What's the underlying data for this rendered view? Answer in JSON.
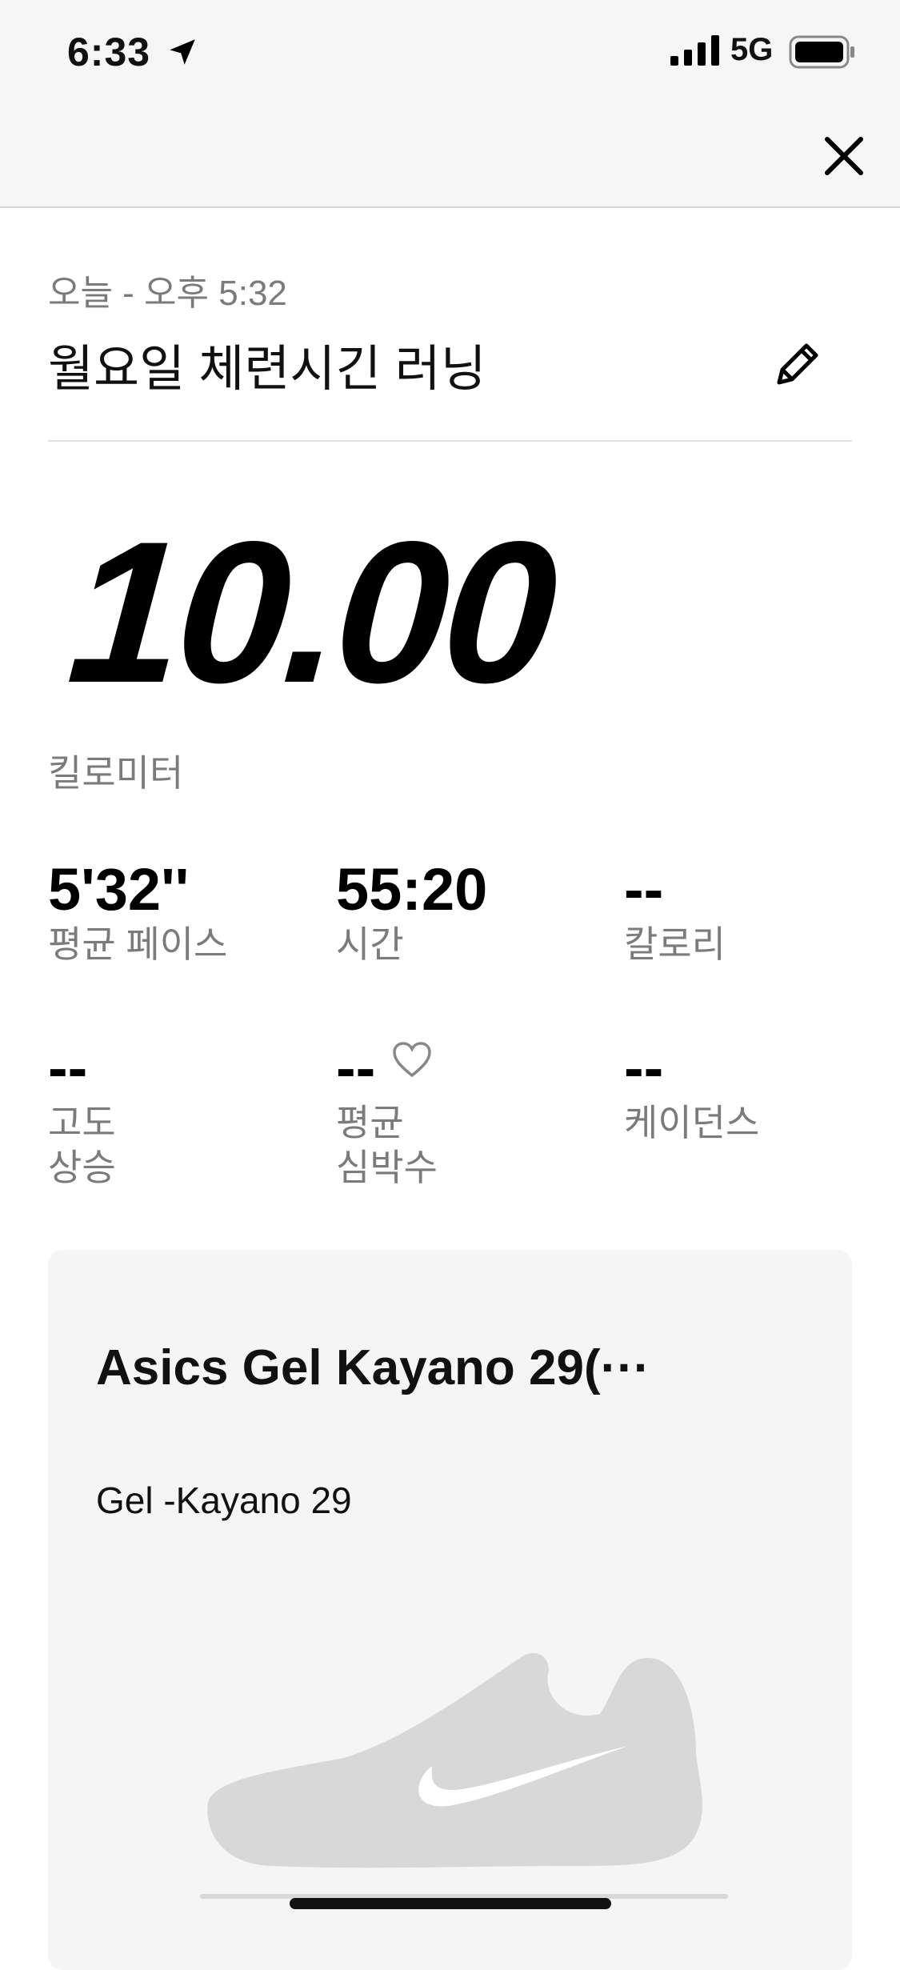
{
  "status_bar": {
    "time": "6:33",
    "network": "5G"
  },
  "run": {
    "when": "오늘 - 오후 5:32",
    "title": "월요일 체련시긴 러닝",
    "distance": "10.00",
    "distance_unit": "킬로미터"
  },
  "stats": [
    {
      "value": "5'32''",
      "label": "평균 페이스"
    },
    {
      "value": "55:20",
      "label": "시간"
    },
    {
      "value": "--",
      "label": "칼로리"
    },
    {
      "value": "--",
      "label_line1": "고도",
      "label_line2": "상승"
    },
    {
      "value": "--",
      "label_line1": "평균",
      "label_line2": "심박수"
    },
    {
      "value": "--",
      "label": "케이던스"
    }
  ],
  "shoe": {
    "name": "Asics Gel Kayano 29(···",
    "model": "Gel -Kayano 29"
  }
}
